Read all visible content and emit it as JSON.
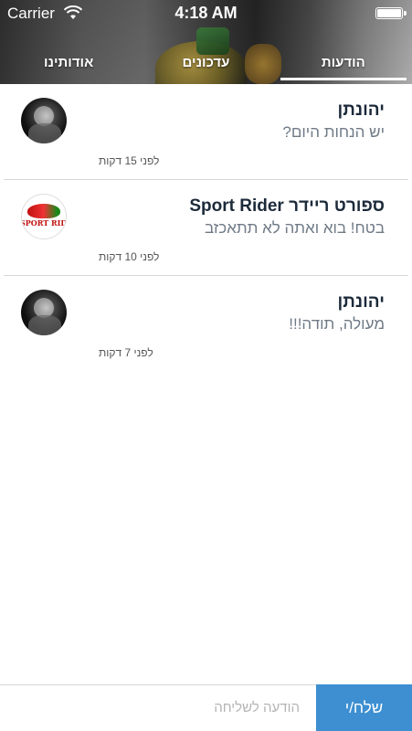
{
  "status_bar": {
    "carrier": "Carrier",
    "time": "4:18 AM"
  },
  "tabs": [
    {
      "label": "אודותינו",
      "active": false
    },
    {
      "label": "עדכונים",
      "active": false
    },
    {
      "label": "הודעות",
      "active": true
    }
  ],
  "messages": [
    {
      "sender": "יהונתן",
      "text": "יש הנחות היום?",
      "time_ago": "לפני 15 דקות",
      "avatar": "profile-photo"
    },
    {
      "sender": "ספורט ריידר Sport Rider",
      "text": "בטח! בוא ואתה לא תתאכזב",
      "time_ago": "לפני 10 דקות",
      "avatar": "sport-rider-logo",
      "avatar_logo_text": "SPORT RIDER"
    },
    {
      "sender": "יהונתן",
      "text": "מעולה, תודה!!!",
      "time_ago": "לפני 7 דקות",
      "avatar": "profile-photo"
    }
  ],
  "composer": {
    "placeholder": "הודעה לשליחה",
    "send_label": "שלח/י"
  },
  "colors": {
    "send_button": "#3d8fd1",
    "sender_name": "#1c2a3a",
    "message_text": "#6f7a86"
  }
}
